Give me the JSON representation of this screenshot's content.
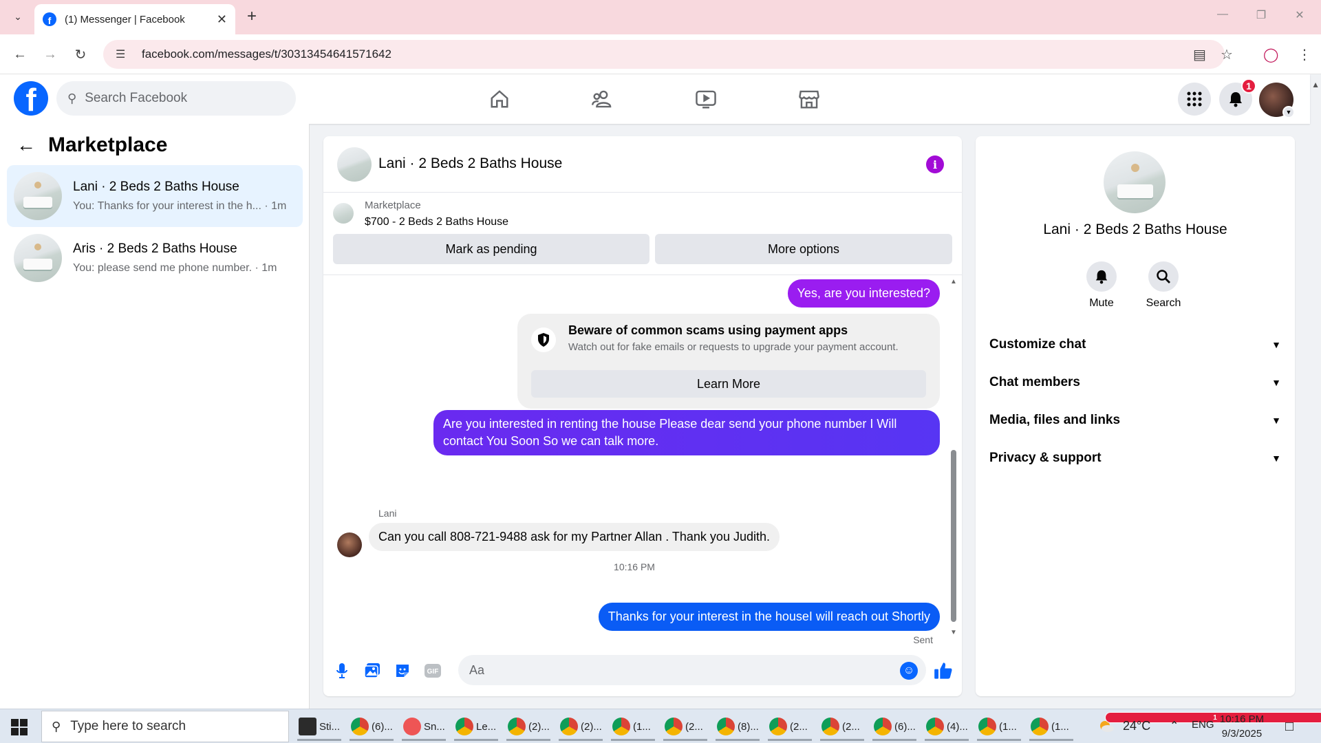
{
  "browser": {
    "tab_title": "(1) Messenger | Facebook",
    "url": "facebook.com/messages/t/30313454641571642"
  },
  "header": {
    "search_placeholder": "Search Facebook",
    "notification_count": "1"
  },
  "sidebar": {
    "title": "Marketplace",
    "conversations": [
      {
        "name": "Lani · 2 Beds 2 Baths House",
        "snippet": "You: Thanks for your interest in the h... · 1m",
        "active": true
      },
      {
        "name": "Aris · 2 Beds 2 Baths House",
        "snippet": "You: please send me phone number. · 1m",
        "active": false
      }
    ]
  },
  "chat": {
    "title": "Lani · 2 Beds 2 Baths House",
    "marketplace_label": "Marketplace",
    "listing": "$700 - 2 Beds 2 Baths House",
    "mark_pending_label": "Mark as pending",
    "more_options_label": "More options",
    "messages": {
      "out1": "Yes, are you interested?",
      "scam_title": "Beware of common scams using payment apps",
      "scam_body": "Watch out for fake emails or requests to upgrade your payment account.",
      "learn_more": "Learn More",
      "out2": "Are you interested in renting the house Please dear send your phone  number  I Will contact You Soon So we can talk more.",
      "sender": "Lani",
      "in1": "Can you call 808-721-9488 ask for my Partner Allan . Thank you Judith.",
      "timestamp": "10:16 PM",
      "out3": "Thanks for your interest in the houseI will reach out Shortly",
      "status": "Sent"
    },
    "composer_placeholder": "Aa"
  },
  "right_panel": {
    "name": "Lani · 2 Beds 2 Baths House",
    "mute_label": "Mute",
    "search_label": "Search",
    "rows": [
      "Customize chat",
      "Chat members",
      "Media, files and links",
      "Privacy & support"
    ]
  },
  "taskbar": {
    "search_placeholder": "Type here to search",
    "apps": [
      "Sti...",
      "(6)...",
      "Sn...",
      "Le...",
      "(2)...",
      "(2)...",
      "(1...",
      "(2...",
      "(8)...",
      "(2...",
      "(2...",
      "(6)...",
      "(4)...",
      "(1...",
      "(1..."
    ],
    "weather_badge": "1",
    "temperature": "24°C",
    "language": "ENG",
    "time": "10:16 PM",
    "date": "9/3/2025"
  },
  "colors": {
    "fb_blue": "#0866ff",
    "bubble_purple": "#7a1af6",
    "bubble_blue": "#0a5cf5",
    "info_purple": "#a20bd6",
    "notification_red": "#e41e3f"
  }
}
